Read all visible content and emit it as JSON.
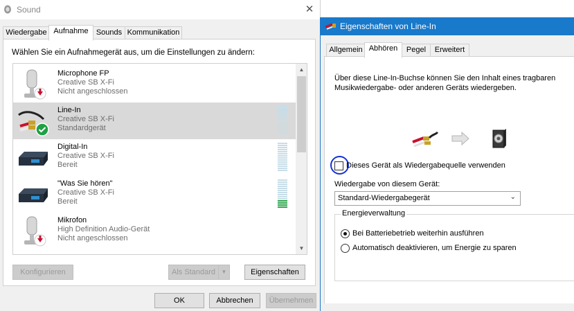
{
  "sound": {
    "title": "Sound",
    "close_glyph": "✕",
    "tabs": [
      {
        "label": "Wiedergabe"
      },
      {
        "label": "Aufnahme"
      },
      {
        "label": "Sounds"
      },
      {
        "label": "Kommunikation"
      }
    ],
    "active_tab": "Aufnahme",
    "instruction": "Wählen Sie ein Aufnahmegerät aus, um die Einstellungen zu ändern:",
    "devices": [
      {
        "name": "Microphone FP",
        "driver": "Creative SB X-Fi",
        "status": "Nicht angeschlossen",
        "icon": "microphone-icon",
        "badge": "disconnected-arrow-icon"
      },
      {
        "name": "Line-In",
        "driver": "Creative SB X-Fi",
        "status": "Standardgerät",
        "icon": "audio-cable-icon",
        "badge": "default-check-icon",
        "selected": true
      },
      {
        "name": "Digital-In",
        "driver": "Creative SB X-Fi",
        "status": "Bereit",
        "icon": "audio-device-icon"
      },
      {
        "name": "\"Was Sie hören\"",
        "driver": "Creative SB X-Fi",
        "status": "Bereit",
        "icon": "audio-device-icon"
      },
      {
        "name": "Mikrofon",
        "driver": "High Definition Audio-Gerät",
        "status": "Nicht angeschlossen",
        "icon": "microphone-icon",
        "badge": "disconnected-arrow-icon"
      }
    ],
    "buttons": {
      "configure": "Konfigurieren",
      "set_default": "Als Standard",
      "properties": "Eigenschaften",
      "ok": "OK",
      "cancel": "Abbrechen",
      "apply": "Übernehmen"
    }
  },
  "properties": {
    "title": "Eigenschaften von Line-In",
    "tabs": [
      {
        "label": "Allgemein"
      },
      {
        "label": "Abhören"
      },
      {
        "label": "Pegel"
      },
      {
        "label": "Erweitert"
      }
    ],
    "active_tab": "Abhören",
    "description": "Über diese Line-In-Buchse können Sie den Inhalt eines tragbaren Musikwiedergabe- oder anderen Geräts wiedergeben.",
    "listen_checkbox_label": "Dieses Gerät als Wiedergabequelle verwenden",
    "listen_checked": false,
    "playback_label": "Wiedergabe von diesem Gerät:",
    "playback_selected": "Standard-Wiedergabegerät",
    "energy_label": "Energieverwaltung",
    "energy_options": [
      {
        "label": "Bei Batteriebetrieb weiterhin ausführen",
        "selected": true
      },
      {
        "label": "Automatisch deaktivieren, um Energie zu sparen",
        "selected": false
      }
    ]
  },
  "colors": {
    "accent": "#1979ca",
    "selected_row": "#d9d9d9",
    "meter_active": "#2aa14a",
    "annotation_circle": "#1530d8"
  }
}
